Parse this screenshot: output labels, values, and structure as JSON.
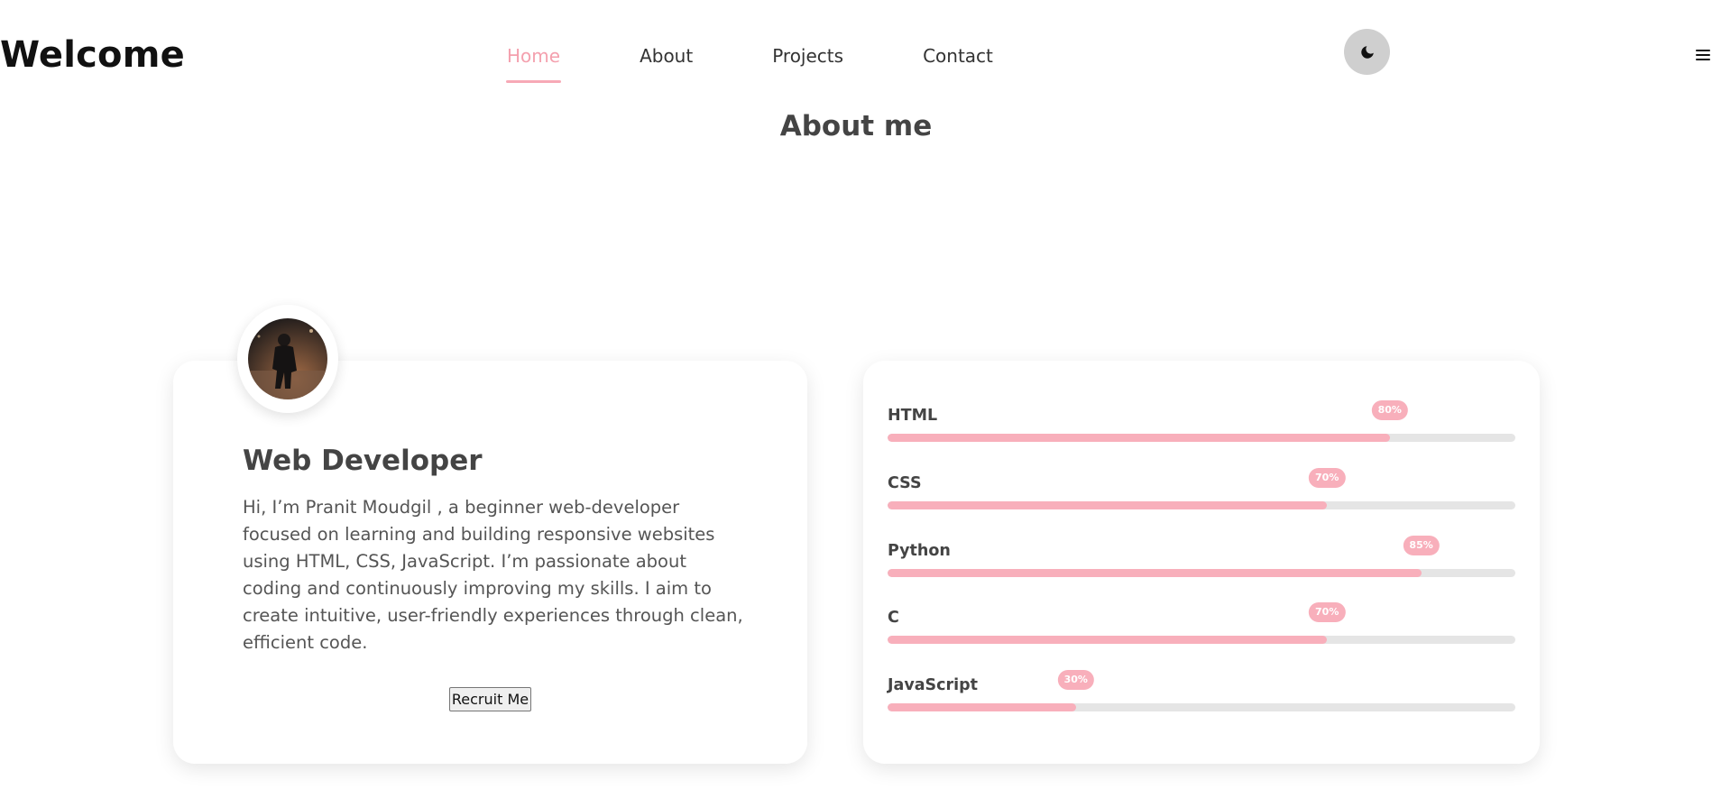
{
  "header": {
    "brand": "Welcome",
    "nav": [
      {
        "label": "Home",
        "active": true
      },
      {
        "label": "About",
        "active": false
      },
      {
        "label": "Projects",
        "active": false
      },
      {
        "label": "Contact",
        "active": false
      }
    ],
    "theme_toggle_icon": "moon-icon",
    "menu_icon": "hamburger-icon"
  },
  "about": {
    "section_title": "About me",
    "avatar_icon": "profile-photo",
    "role": "Web Developer",
    "bio": "Hi, I’m Pranit Moudgil , a beginner web-developer focused on learning and building responsive websites using HTML, CSS, JavaScript. I’m passionate about coding and continuously improving my skills. I aim to create intuitive, user-friendly experiences through clean, efficient code.",
    "button_label": "Recruit Me"
  },
  "skills": [
    {
      "name": "HTML",
      "percent": 80,
      "label": "80%"
    },
    {
      "name": "CSS",
      "percent": 70,
      "label": "70%"
    },
    {
      "name": "Python",
      "percent": 85,
      "label": "85%"
    },
    {
      "name": "C",
      "percent": 70,
      "label": "70%"
    },
    {
      "name": "JavaScript",
      "percent": 30,
      "label": "30%"
    }
  ],
  "colors": {
    "accent": "#f8afbb",
    "track": "#e5e5e5",
    "toggle_bg": "#cfcfcf"
  }
}
